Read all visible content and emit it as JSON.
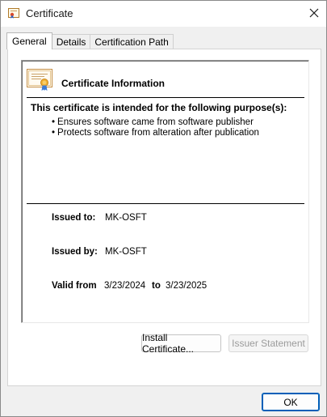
{
  "window": {
    "title": "Certificate",
    "close_label": "×"
  },
  "tabs": [
    {
      "label": "General",
      "active": true
    },
    {
      "label": "Details",
      "active": false
    },
    {
      "label": "Certification Path",
      "active": false
    }
  ],
  "general": {
    "info_title": "Certificate Information",
    "purpose_heading": "This certificate is intended for the following purpose(s):",
    "purposes": [
      "Ensures software came from software publisher",
      "Protects software from alteration after publication"
    ],
    "issued_to_label": "Issued to:",
    "issued_to_value": "MK-OSFT",
    "issued_by_label": "Issued by:",
    "issued_by_value": "MK-OSFT",
    "valid_from_label": "Valid from",
    "valid_from_value": "3/23/2024",
    "valid_to_label": "to",
    "valid_to_value": "3/23/2025"
  },
  "buttons": {
    "install": "Install Certificate...",
    "issuer_statement": "Issuer Statement",
    "ok": "OK"
  },
  "icons": {
    "title_icon": "certificate-icon",
    "close_icon": "close-icon",
    "cert_info_icon": "certificate-icon"
  },
  "colors": {
    "window_bg": "#f0f0f0",
    "panel_bg": "#ffffff",
    "accent": "#005fb8",
    "disabled_text": "#9b9b9b"
  }
}
